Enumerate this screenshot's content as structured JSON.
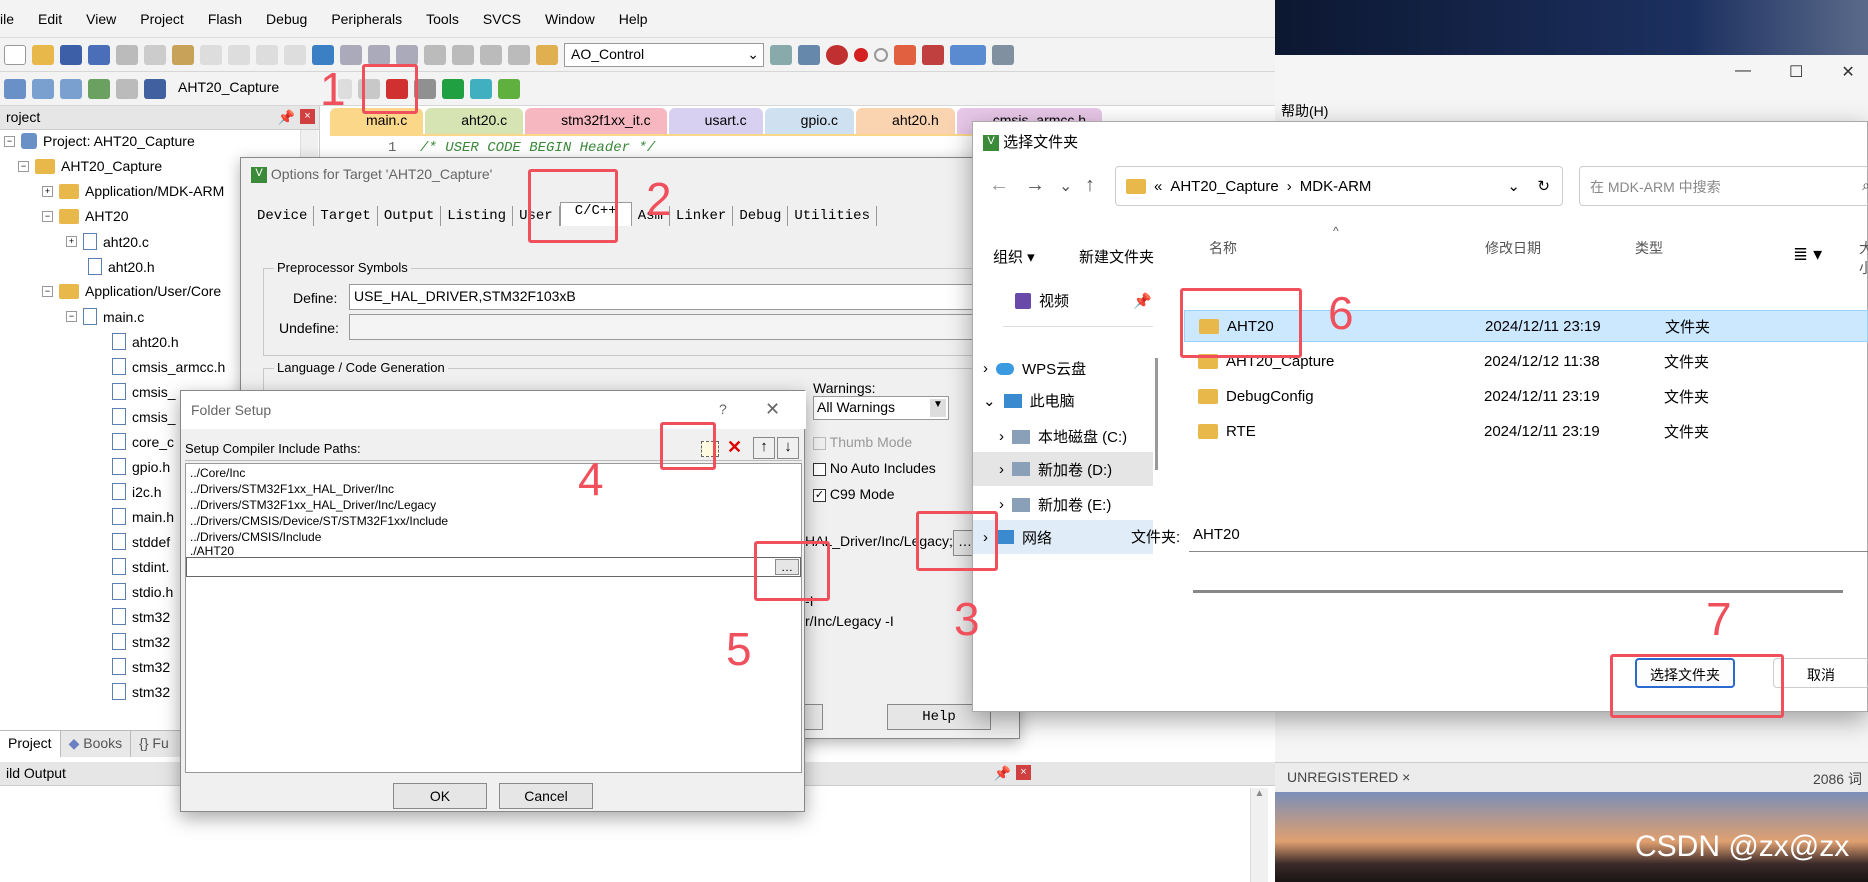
{
  "menu": [
    "ile",
    "Edit",
    "View",
    "Project",
    "Flash",
    "Debug",
    "Peripherals",
    "Tools",
    "SVCS",
    "Window",
    "Help"
  ],
  "toolbar1": {
    "target_combo": "AO_Control"
  },
  "toolbar2": {
    "project_combo": "AHT20_Capture"
  },
  "project_panel": {
    "title": "roject",
    "tree": [
      "Project: AHT20_Capture",
      "AHT20_Capture",
      "Application/MDK-ARM",
      "AHT20",
      "aht20.c",
      "aht20.h",
      "Application/User/Core",
      "main.c",
      "aht20.h",
      "cmsis_armcc.h",
      "cmsis_",
      "cmsis_",
      "core_c",
      "gpio.h",
      "i2c.h",
      "main.h",
      "stddef",
      "stdint.",
      "stdio.h",
      "stm32",
      "stm32",
      "stm32",
      "stm32"
    ],
    "bottom_tabs": [
      "Project",
      "Books",
      "Fu"
    ]
  },
  "editor_tabs": [
    "main.c",
    "aht20.c",
    "stm32f1xx_it.c",
    "usart.c",
    "gpio.c",
    "aht20.h",
    "cmsis_armcc.h"
  ],
  "editor": {
    "line_no": "1",
    "line_text": "/* USER CODE BEGIN Header */"
  },
  "options": {
    "title": "Options for Target 'AHT20_Capture'",
    "tabs": [
      "Device",
      "Target",
      "Output",
      "Listing",
      "User",
      "C/C++",
      "Asm",
      "Linker",
      "Debug",
      "Utilities"
    ],
    "preproc_label": "Preprocessor Symbols",
    "define_label": "Define:",
    "define_value": "USE_HAL_DRIVER,STM32F103xB",
    "undefine_label": "Undefine:",
    "lang_label": "Language / Code Generation",
    "warnings_label": "Warnings:",
    "warnings_value": "All Warnings",
    "thumb_mode": "Thumb Mode",
    "no_auto": "No Auto Includes",
    "c99": "C99 Mode",
    "include_paths_tail": "HAL_Driver/Inc/Legacy;",
    "misc_text_1": "-I",
    "misc_text_2": "r/Inc/Legacy -I",
    "help_btn": "Help"
  },
  "folder_setup": {
    "title": "Folder Setup",
    "help": "?",
    "label": "Setup Compiler Include Paths:",
    "paths": [
      "../Core/Inc",
      "../Drivers/STM32F1xx_HAL_Driver/Inc",
      "../Drivers/STM32F1xx_HAL_Driver/Inc/Legacy",
      "../Drivers/CMSIS/Device/ST/STM32F1xx/Include",
      "../Drivers/CMSIS/Include",
      "./AHT20"
    ],
    "ok": "OK",
    "cancel": "Cancel"
  },
  "select_folder": {
    "title": "选择文件夹",
    "breadcrumb": [
      "«",
      "AHT20_Capture",
      "MDK-ARM"
    ],
    "search_placeholder": "在 MDK-ARM 中搜索",
    "organize": "组织",
    "new_folder": "新建文件夹",
    "nav": [
      "视频",
      "WPS云盘",
      "此电脑",
      "本地磁盘 (C:)",
      "新加卷 (D:)",
      "新加卷 (E:)",
      "网络"
    ],
    "columns": [
      "名称",
      "修改日期",
      "类型",
      "大小"
    ],
    "rows": [
      {
        "name": "AHT20",
        "date": "2024/12/11 23:19",
        "type": "文件夹"
      },
      {
        "name": "AHT20_Capture",
        "date": "2024/12/12 11:38",
        "type": "文件夹"
      },
      {
        "name": "DebugConfig",
        "date": "2024/12/11 23:19",
        "type": "文件夹"
      },
      {
        "name": "RTE",
        "date": "2024/12/11 23:19",
        "type": "文件夹"
      }
    ],
    "folder_label": "文件夹:",
    "folder_value": "AHT20",
    "select_btn": "选择文件夹",
    "cancel_btn": "取消"
  },
  "bg_window": {
    "help_menu": "帮助(H)",
    "unregistered": "UNREGISTERED ×",
    "word_count": "2086 词",
    "watermark": "CSDN @zx@zx"
  },
  "build_output": {
    "title": "ild Output"
  },
  "annotations": [
    "1",
    "2",
    "3",
    "4",
    "5",
    "6",
    "7"
  ],
  "colors": {
    "annotation_red": "#f0505c",
    "selected_row": "#cce8ff",
    "dialog_bg": "#f0f0f0"
  }
}
